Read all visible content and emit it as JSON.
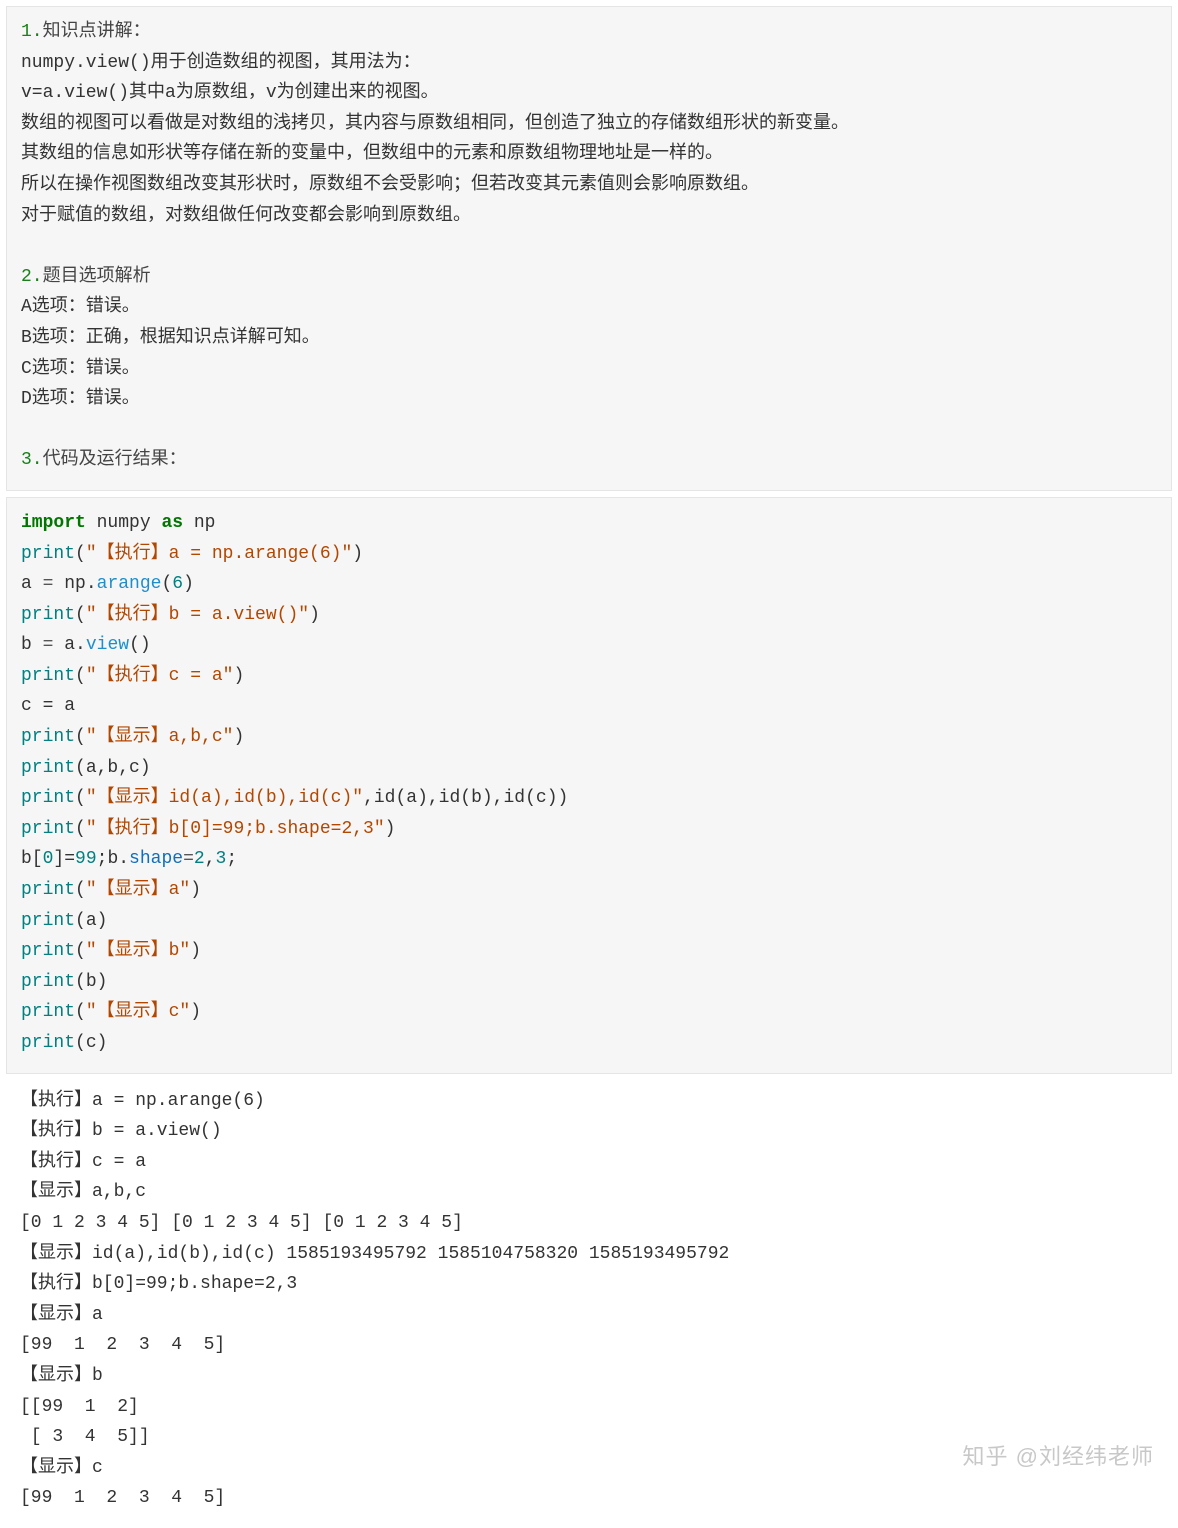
{
  "section1": {
    "heading_num": "1.",
    "heading_text": "知识点讲解：",
    "lines": [
      "numpy.view()用于创造数组的视图，其用法为：",
      "v=a.view()其中a为原数组，v为创建出来的视图。",
      "数组的视图可以看做是对数组的浅拷贝，其内容与原数组相同，但创造了独立的存储数组形状的新变量。",
      "其数组的信息如形状等存储在新的变量中，但数组中的元素和原数组物理地址是一样的。",
      "所以在操作视图数组改变其形状时，原数组不会受影响；但若改变其元素值则会影响原数组。",
      "对于赋值的数组，对数组做任何改变都会影响到原数组。"
    ]
  },
  "section2": {
    "heading_num": "2.",
    "heading_text": "题目选项解析",
    "lines": [
      "A选项：错误。",
      "B选项：正确，根据知识点详解可知。",
      "C选项：错误。",
      "D选项：错误。"
    ]
  },
  "section3": {
    "heading_num": "3.",
    "heading_text": "代码及运行结果："
  },
  "code": {
    "l1": {
      "import": "import",
      "numpy": " numpy ",
      "as": "as",
      "np": " np"
    },
    "l2": {
      "print": "print",
      "open": "(",
      "str": "\"【执行】a = np.arange(6)\"",
      "close": ")"
    },
    "l3": {
      "a": "a ",
      "eq": "= ",
      "np": "np",
      "dot": ".",
      "arange": "arange",
      "args": "(",
      "six": "6",
      "close": ")"
    },
    "l4": {
      "print": "print",
      "open": "(",
      "str": "\"【执行】b = a.view()\"",
      "close": ")"
    },
    "l5": {
      "b": "b ",
      "eq": "= ",
      "a": "a",
      "dot": ".",
      "view": "view",
      "paren": "()"
    },
    "l6": {
      "print": "print",
      "open": "(",
      "str": "\"【执行】c = a\"",
      "close": ")"
    },
    "l7": {
      "text": "c = a"
    },
    "l8": {
      "print": "print",
      "open": "(",
      "str": "\"【显示】a,b,c\"",
      "close": ")"
    },
    "l9": {
      "print": "print",
      "args": "(a,b,c)"
    },
    "l10": {
      "print": "print",
      "open": "(",
      "str": "\"【显示】id(a),id(b),id(c)\"",
      "rest": ",id(a),id(b),id(c))"
    },
    "l11": {
      "print": "print",
      "open": "(",
      "str": "\"【执行】b[0]=99;b.shape=2,3\"",
      "close": ")"
    },
    "l12": {
      "pre": "b[",
      "zero": "0",
      "mid": "]=",
      "ninetynine": "99",
      "semi": ";b.",
      "shape": "shape",
      "eq": "=",
      "two": "2",
      "comma": ",",
      "three": "3",
      "end": ";"
    },
    "l13": {
      "print": "print",
      "open": "(",
      "str": "\"【显示】a\"",
      "close": ")"
    },
    "l14": {
      "print": "print",
      "args": "(a)"
    },
    "l15": {
      "print": "print",
      "open": "(",
      "str": "\"【显示】b\"",
      "close": ")"
    },
    "l16": {
      "print": "print",
      "args": "(b)"
    },
    "l17": {
      "print": "print",
      "open": "(",
      "str": "\"【显示】c\"",
      "close": ")"
    },
    "l18": {
      "print": "print",
      "args": "(c)"
    }
  },
  "output": [
    "【执行】a = np.arange(6)",
    "【执行】b = a.view()",
    "【执行】c = a",
    "【显示】a,b,c",
    "[0 1 2 3 4 5] [0 1 2 3 4 5] [0 1 2 3 4 5]",
    "【显示】id(a),id(b),id(c) 1585193495792 1585104758320 1585193495792",
    "【执行】b[0]=99;b.shape=2,3",
    "【显示】a",
    "[99  1  2  3  4  5]",
    "【显示】b",
    "[[99  1  2]",
    " [ 3  4  5]]",
    "【显示】c",
    "[99  1  2  3  4  5]"
  ],
  "watermark": "知乎 @刘经纬老师"
}
